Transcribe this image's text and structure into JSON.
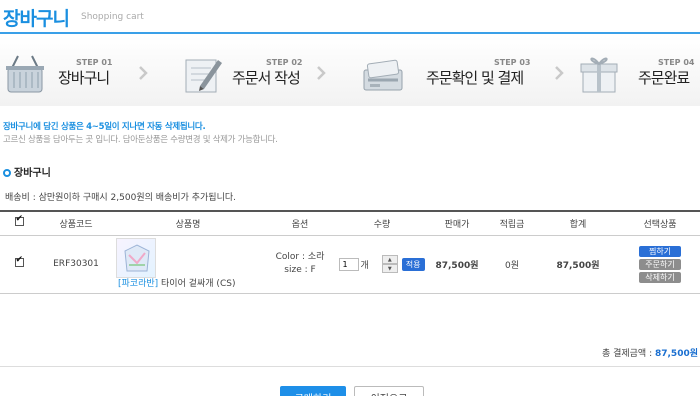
{
  "header": {
    "title": "장바구니",
    "subtitle": "Shopping cart"
  },
  "steps": [
    {
      "num": "STEP 01",
      "label": "장바구니",
      "icon": "basket-icon"
    },
    {
      "num": "STEP 02",
      "label": "주문서 작성",
      "icon": "pencil-form-icon"
    },
    {
      "num": "STEP 03",
      "label": "주문확인 및 결제",
      "icon": "payment-card-icon"
    },
    {
      "num": "STEP 04",
      "label": "주문완료",
      "icon": "gift-box-icon"
    }
  ],
  "notice": {
    "line1": "장바구니에 담긴 상품은 4~5일이 지나면 자동 삭제됩니다.",
    "line2": "고르신 상품을 담아두는 곳 입니다.  담아둔상품은 수량변경 및 삭제가 가능합니다."
  },
  "section_title": "장바구니",
  "shipping_note": "배송비 : 삼만원이하 구매시 2,500원의 배송비가 추가됩니다.",
  "table": {
    "headers": [
      "상품코드",
      "상품명",
      "옵션",
      "수량",
      "판매가",
      "적립금",
      "합계",
      "선택상품"
    ],
    "rows": [
      {
        "code": "ERF30301",
        "brand": "[파코라반]",
        "name": "타이어 겉싸개 (CS)",
        "option_color": "Color : 소라",
        "option_size": "size : F",
        "qty": "1",
        "qty_unit": "개",
        "apply": "적용",
        "price": "87,500원",
        "points": "0원",
        "total": "87,500원",
        "actions": [
          "찜하기",
          "주문하기",
          "삭제하기"
        ]
      }
    ]
  },
  "summary": {
    "label": "총 결제금액 :",
    "value": "87,500원"
  },
  "buttons": {
    "buy": "구매하기",
    "prev": "이전으로"
  },
  "colors": {
    "accent": "#1a8fe0",
    "button_blue": "#2a6fd6",
    "button_gray": "#8d8d8d"
  }
}
